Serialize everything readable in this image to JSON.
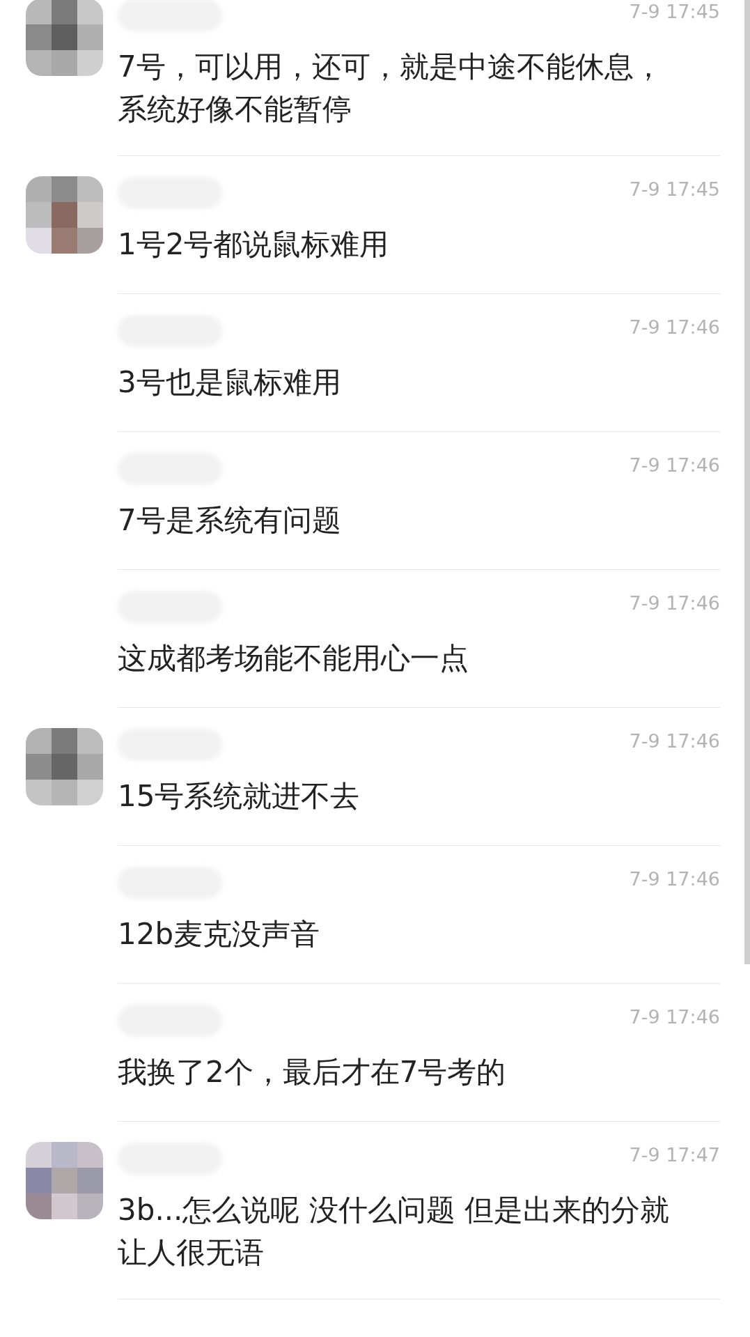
{
  "comments": [
    {
      "avatar": true,
      "time": "7-9 17:45",
      "lines": [
        "7号，可以用，还可，就是中途不能休息，",
        "系统好像不能暂停"
      ]
    },
    {
      "avatar": true,
      "time": "7-9 17:45",
      "lines": [
        "1号2号都说鼠标难用"
      ]
    },
    {
      "avatar": false,
      "time": "7-9 17:46",
      "lines": [
        "3号也是鼠标难用"
      ]
    },
    {
      "avatar": false,
      "time": "7-9 17:46",
      "lines": [
        "7号是系统有问题"
      ]
    },
    {
      "avatar": false,
      "time": "7-9 17:46",
      "lines": [
        "这成都考场能不能用心一点"
      ]
    },
    {
      "avatar": true,
      "time": "7-9 17:46",
      "lines": [
        "15号系统就进不去"
      ]
    },
    {
      "avatar": false,
      "time": "7-9 17:46",
      "lines": [
        "12b麦克没声音"
      ]
    },
    {
      "avatar": false,
      "time": "7-9 17:46",
      "lines": [
        "我换了2个，最后才在7号考的"
      ]
    },
    {
      "avatar": true,
      "time": "7-9 17:47",
      "lines": [
        "3b...怎么说呢 没什么问题 但是出来的分就",
        "让人很无语"
      ]
    }
  ]
}
